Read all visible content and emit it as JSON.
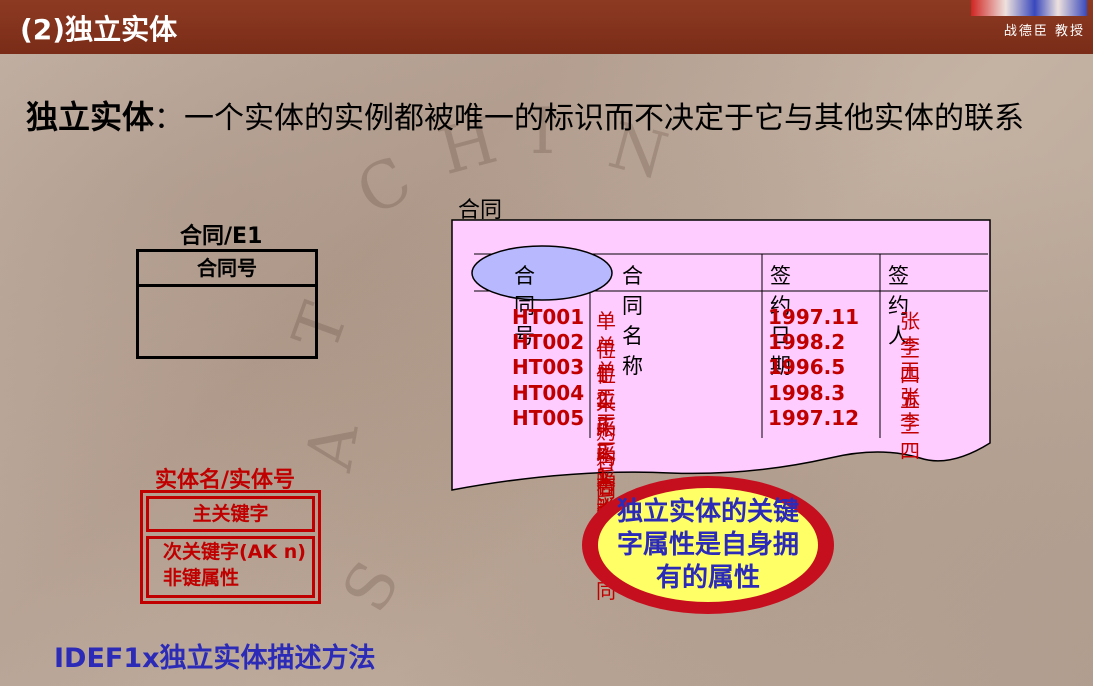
{
  "header": {
    "title": "(2)独立实体",
    "author": "战德臣 教授"
  },
  "heading": {
    "term": "独立实体",
    "definition": "：一个实体的实例都被唯一的标识而不决定于它与其他实体的联系"
  },
  "watermark": [
    "C",
    "H",
    "I",
    "N",
    "A",
    "S",
    "T"
  ],
  "entity": {
    "name": "合同/E1",
    "key": "合同号"
  },
  "legend": {
    "title": "实体名/实体号",
    "primary_key": "主关键字",
    "attr_line1": "次关键字(AK n)",
    "attr_line2": "非键属性"
  },
  "caption": "IDEF1x独立实体描述方法",
  "table": {
    "label": "合同",
    "headers": [
      "合同号",
      "合同名称",
      "签约日期",
      "签约人"
    ],
    "rows": [
      [
        "HT001",
        "单位1采购合同",
        "1997.11",
        "张三"
      ],
      [
        "HT002",
        "单位2采购合同",
        "1998.2",
        "李四"
      ],
      [
        "HT003",
        "单位3采购合同",
        "1996.5",
        "王五"
      ],
      [
        "HT004",
        "工厂2采购合同",
        "1998.3",
        "张三"
      ],
      [
        "HT005",
        "工厂1采购合同",
        "1997.12",
        "李四"
      ]
    ]
  },
  "callout": "独立实体的关键字属性是自身拥有的属性",
  "colors": {
    "header_bg": "#7a2c18",
    "red": "#c00000",
    "blue": "#2b2bb8",
    "card_fill": "#ffccff",
    "bubble_fill": "#ffff66"
  }
}
